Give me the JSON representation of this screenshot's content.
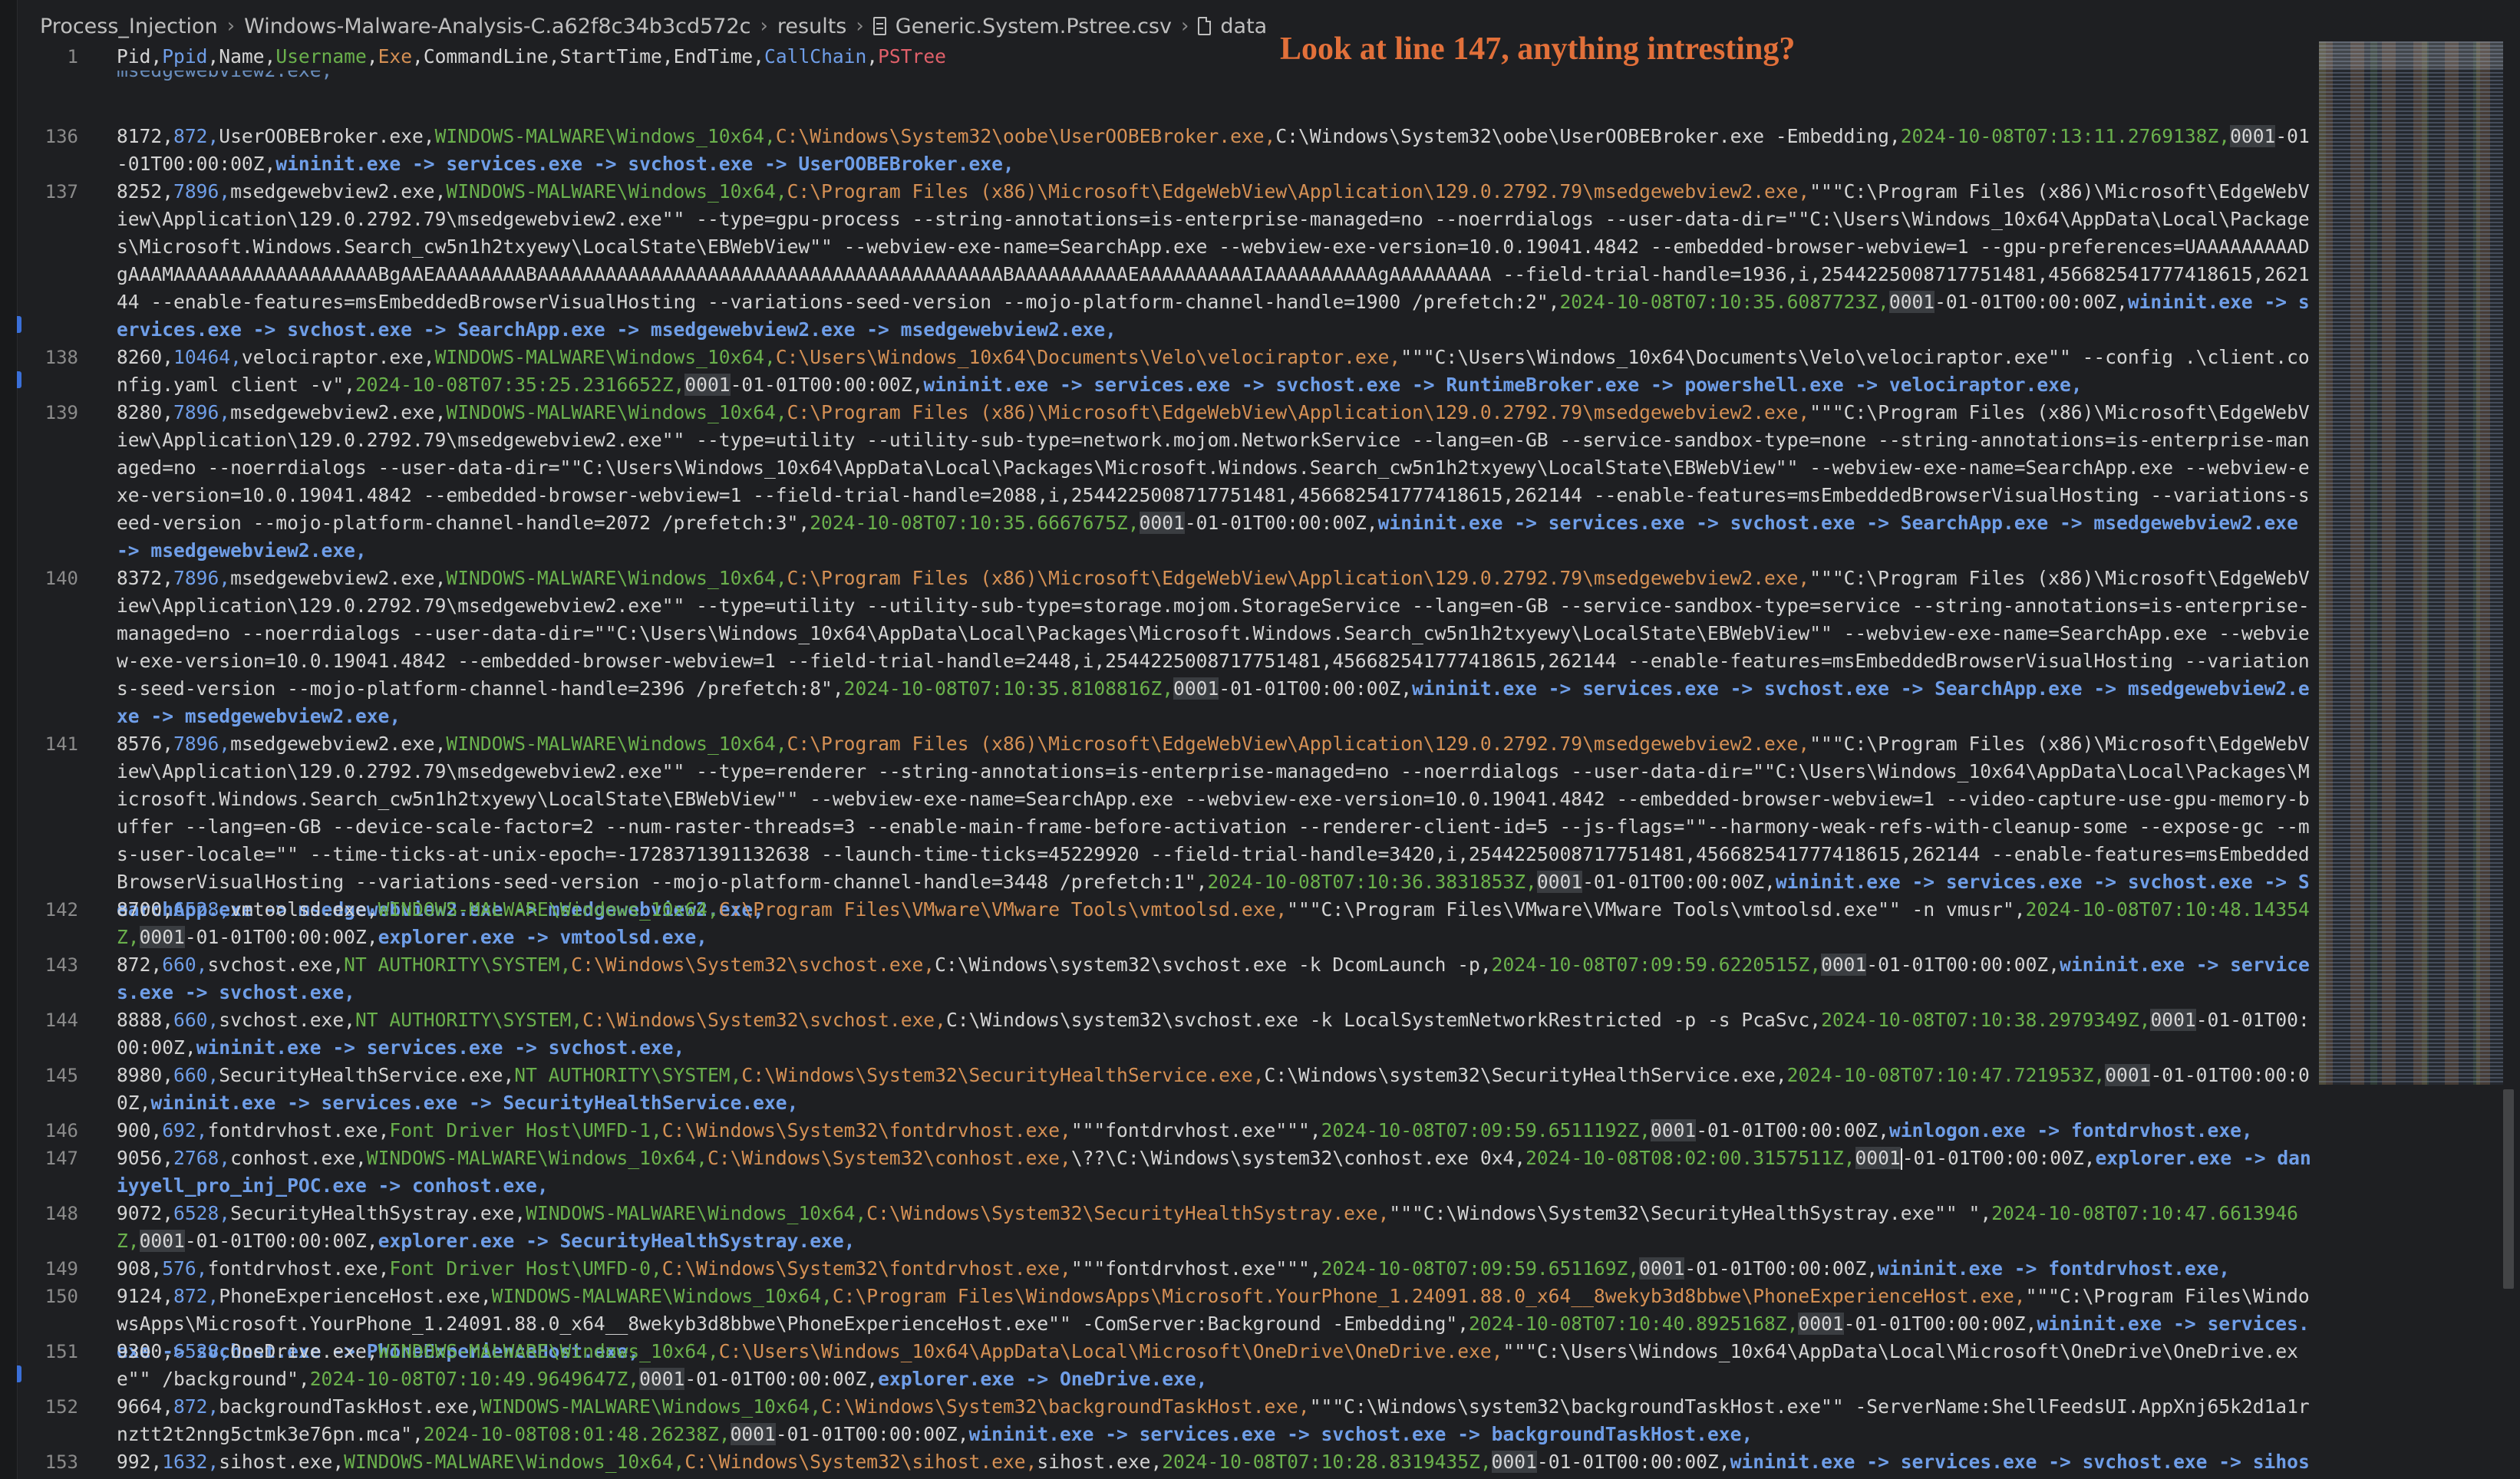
{
  "breadcrumb": {
    "items": [
      "Process_Injection",
      "Windows-Malware-Analysis-C.a62f8c34b3cd572c",
      "results",
      "Generic.System.Pstree.csv",
      "data"
    ]
  },
  "annotation": "Look at line 147, anything intresting?",
  "header": {
    "line_number": "1",
    "cols_plain1": "Pid,",
    "col_ppid": "Ppid",
    "cols_plain2": ",Name,",
    "col_username": "Username",
    "col_sep1": ",",
    "col_exe": "Exe",
    "cols_plain3": ",CommandLine,StartTime,EndTime,",
    "col_callchain": "CallChain",
    "col_sep2": ",",
    "col_pstree": "PSTree"
  },
  "scrolled_fragment": "msedgewebview2.exe,",
  "lines": [
    {
      "n": "136",
      "pid": "8172,",
      "ppid": "872,",
      "name": "UserOOBEBroker.exe,",
      "user": "WINDOWS-MALWARE\\Windows_10x64,",
      "exe": "C:\\Windows\\System32\\oobe\\UserOOBEBroker.exe,",
      "cmd": "C:\\Windows\\System32\\oobe\\UserOOBEBroker.exe -Embedding,",
      "start": "2024-10-08T07:13:11.2769138Z,",
      "zero": "0001",
      "end": "-01-01T00:00:00Z,",
      "chain": "wininit.exe -> services.exe -> svchost.exe -> UserOOBEBroker.exe,"
    },
    {
      "n": "137",
      "pid": "8252,",
      "ppid": "7896,",
      "name": "msedgewebview2.exe,",
      "user": "WINDOWS-MALWARE\\Windows_10x64,",
      "exe": "C:\\Program Files (x86)\\Microsoft\\EdgeWebView\\Application\\129.0.2792.79\\msedgewebview2.exe,",
      "cmd": "\"\"\"C:\\Program Files (x86)\\Microsoft\\EdgeWebView\\Application\\129.0.2792.79\\msedgewebview2.exe\"\" --type=gpu-process --string-annotations=is-enterprise-managed=no --noerrdialogs --user-data-dir=\"\"C:\\Users\\Windows_10x64\\AppData\\Local\\Packages\\Microsoft.Windows.Search_cw5n1h2txyewy\\LocalState\\EBWebView\"\" --webview-exe-name=SearchApp.exe --webview-exe-version=10.0.19041.4842 --embedded-browser-webview=1 --gpu-preferences=UAAAAAAAAADgAAAMAAAAAAAAAAAAAAAAAABgAAEAAAAAAAABAAAAAAAAAAAAAAAAAAAAAAAAAAAAAAAAAAAAAAAAABAAAAAAAAAAEAAAAAAAAAAIAAAAAAAAAAgAAAAAAAAA --field-trial-handle=1936,i,2544225008717751481,456682541777418615,262144 --enable-features=msEmbeddedBrowserVisualHosting --variations-seed-version --mojo-platform-channel-handle=1900 /prefetch:2\",",
      "start": "2024-10-08T07:10:35.6087723Z,",
      "zero": "0001",
      "end": "-01-01T00:00:00Z,",
      "chain": "wininit.exe -> services.exe -> svchost.exe -> SearchApp.exe -> msedgewebview2.exe -> msedgewebview2.exe,"
    },
    {
      "n": "138",
      "pid": "8260,",
      "ppid": "10464,",
      "name": "velociraptor.exe,",
      "user": "WINDOWS-MALWARE\\Windows_10x64,",
      "exe": "C:\\Users\\Windows_10x64\\Documents\\Velo\\velociraptor.exe,",
      "cmd": "\"\"\"C:\\Users\\Windows_10x64\\Documents\\Velo\\velociraptor.exe\"\" --config .\\client.config.yaml client -v\",",
      "start": "2024-10-08T07:35:25.2316652Z,",
      "zero": "0001",
      "end": "-01-01T00:00:00Z,",
      "chain": "wininit.exe -> services.exe -> svchost.exe -> RuntimeBroker.exe -> powershell.exe -> velociraptor.exe,"
    },
    {
      "n": "139",
      "pid": "8280,",
      "ppid": "7896,",
      "name": "msedgewebview2.exe,",
      "user": "WINDOWS-MALWARE\\Windows_10x64,",
      "exe": "C:\\Program Files (x86)\\Microsoft\\EdgeWebView\\Application\\129.0.2792.79\\msedgewebview2.exe,",
      "cmd": "\"\"\"C:\\Program Files (x86)\\Microsoft\\EdgeWebView\\Application\\129.0.2792.79\\msedgewebview2.exe\"\" --type=utility --utility-sub-type=network.mojom.NetworkService --lang=en-GB --service-sandbox-type=none --string-annotations=is-enterprise-managed=no --noerrdialogs --user-data-dir=\"\"C:\\Users\\Windows_10x64\\AppData\\Local\\Packages\\Microsoft.Windows.Search_cw5n1h2txyewy\\LocalState\\EBWebView\"\" --webview-exe-name=SearchApp.exe --webview-exe-version=10.0.19041.4842 --embedded-browser-webview=1 --field-trial-handle=2088,i,2544225008717751481,456682541777418615,262144 --enable-features=msEmbeddedBrowserVisualHosting --variations-seed-version --mojo-platform-channel-handle=2072 /prefetch:3\",",
      "start": "2024-10-08T07:10:35.6667675Z,",
      "zero": "0001",
      "end": "-01-01T00:00:00Z,",
      "chain": "wininit.exe -> services.exe -> svchost.exe -> SearchApp.exe -> msedgewebview2.exe -> msedgewebview2.exe,"
    },
    {
      "n": "140",
      "pid": "8372,",
      "ppid": "7896,",
      "name": "msedgewebview2.exe,",
      "user": "WINDOWS-MALWARE\\Windows_10x64,",
      "exe": "C:\\Program Files (x86)\\Microsoft\\EdgeWebView\\Application\\129.0.2792.79\\msedgewebview2.exe,",
      "cmd": "\"\"\"C:\\Program Files (x86)\\Microsoft\\EdgeWebView\\Application\\129.0.2792.79\\msedgewebview2.exe\"\" --type=utility --utility-sub-type=storage.mojom.StorageService --lang=en-GB --service-sandbox-type=service --string-annotations=is-enterprise-managed=no --noerrdialogs --user-data-dir=\"\"C:\\Users\\Windows_10x64\\AppData\\Local\\Packages\\Microsoft.Windows.Search_cw5n1h2txyewy\\LocalState\\EBWebView\"\" --webview-exe-name=SearchApp.exe --webview-exe-version=10.0.19041.4842 --embedded-browser-webview=1 --field-trial-handle=2448,i,2544225008717751481,456682541777418615,262144 --enable-features=msEmbeddedBrowserVisualHosting --variations-seed-version --mojo-platform-channel-handle=2396 /prefetch:8\",",
      "start": "2024-10-08T07:10:35.8108816Z,",
      "zero": "0001",
      "end": "-01-01T00:00:00Z,",
      "chain": "wininit.exe -> services.exe -> svchost.exe -> SearchApp.exe -> msedgewebview2.exe -> msedgewebview2.exe,"
    },
    {
      "n": "141",
      "pid": "8576,",
      "ppid": "7896,",
      "name": "msedgewebview2.exe,",
      "user": "WINDOWS-MALWARE\\Windows_10x64,",
      "exe": "C:\\Program Files (x86)\\Microsoft\\EdgeWebView\\Application\\129.0.2792.79\\msedgewebview2.exe,",
      "cmd": "\"\"\"C:\\Program Files (x86)\\Microsoft\\EdgeWebView\\Application\\129.0.2792.79\\msedgewebview2.exe\"\" --type=renderer --string-annotations=is-enterprise-managed=no --noerrdialogs --user-data-dir=\"\"C:\\Users\\Windows_10x64\\AppData\\Local\\Packages\\Microsoft.Windows.Search_cw5n1h2txyewy\\LocalState\\EBWebView\"\" --webview-exe-name=SearchApp.exe --webview-exe-version=10.0.19041.4842 --embedded-browser-webview=1 --video-capture-use-gpu-memory-buffer --lang=en-GB --device-scale-factor=2 --num-raster-threads=3 --enable-main-frame-before-activation --renderer-client-id=5 --js-flags=\"\"--harmony-weak-refs-with-cleanup-some --expose-gc --ms-user-locale=\"\" --time-ticks-at-unix-epoch=-1728371391132638 --launch-time-ticks=45229920 --field-trial-handle=3420,i,2544225008717751481,456682541777418615,262144 --enable-features=msEmbeddedBrowserVisualHosting --variations-seed-version --mojo-platform-channel-handle=3448 /prefetch:1\",",
      "start": "2024-10-08T07:10:36.3831853Z,",
      "zero": "0001",
      "end": "-01-01T00:00:00Z,",
      "chain": "wininit.exe -> services.exe -> svchost.exe -> SearchApp.exe -> msedgewebview2.exe -> msedgewebview2.exe,"
    },
    {
      "n": "142",
      "pid": "8700,",
      "ppid": "6528,",
      "name": "vmtoolsd.exe,",
      "user": "WINDOWS-MALWARE\\Windows_10x64,",
      "exe": "C:\\Program Files\\VMware\\VMware Tools\\vmtoolsd.exe,",
      "cmd": "\"\"\"C:\\Program Files\\VMware\\VMware Tools\\vmtoolsd.exe\"\" -n vmusr\",",
      "start": "2024-10-08T07:10:48.14354Z,",
      "zero": "0001",
      "end": "-01-01T00:00:00Z,",
      "chain": "explorer.exe -> vmtoolsd.exe,"
    },
    {
      "n": "143",
      "pid": "872,",
      "ppid": "660,",
      "name": "svchost.exe,",
      "user": "NT AUTHORITY\\SYSTEM,",
      "exe": "C:\\Windows\\System32\\svchost.exe,",
      "cmd": "C:\\Windows\\system32\\svchost.exe -k DcomLaunch -p,",
      "start": "2024-10-08T07:09:59.6220515Z,",
      "zero": "0001",
      "end": "-01-01T00:00:00Z,",
      "chain": "wininit.exe -> services.exe -> svchost.exe,"
    },
    {
      "n": "144",
      "pid": "8888,",
      "ppid": "660,",
      "name": "svchost.exe,",
      "user": "NT AUTHORITY\\SYSTEM,",
      "exe": "C:\\Windows\\System32\\svchost.exe,",
      "cmd": "C:\\Windows\\system32\\svchost.exe -k LocalSystemNetworkRestricted -p -s PcaSvc,",
      "start": "2024-10-08T07:10:38.2979349Z,",
      "zero": "0001",
      "end": "-01-01T00:00:00Z,",
      "chain": "wininit.exe -> services.exe -> svchost.exe,"
    },
    {
      "n": "145",
      "pid": "8980,",
      "ppid": "660,",
      "name": "SecurityHealthService.exe,",
      "user": "NT AUTHORITY\\SYSTEM,",
      "exe": "C:\\Windows\\System32\\SecurityHealthService.exe,",
      "cmd": "C:\\Windows\\system32\\SecurityHealthService.exe,",
      "start": "2024-10-08T07:10:47.721953Z,",
      "zero": "0001",
      "end": "-01-01T00:00:00Z,",
      "chain": "wininit.exe -> services.exe -> SecurityHealthService.exe,"
    },
    {
      "n": "146",
      "pid": "900,",
      "ppid": "692,",
      "name": "fontdrvhost.exe,",
      "user": "Font Driver Host\\UMFD-1,",
      "exe": "C:\\Windows\\System32\\fontdrvhost.exe,",
      "cmd": "\"\"\"fontdrvhost.exe\"\"\",",
      "start": "2024-10-08T07:09:59.6511192Z,",
      "zero": "0001",
      "end": "-01-01T00:00:00Z,",
      "chain": "winlogon.exe -> fontdrvhost.exe,"
    },
    {
      "n": "147",
      "pid": "9056,",
      "ppid": "2768,",
      "name": "conhost.exe,",
      "user": "WINDOWS-MALWARE\\Windows_10x64,",
      "exe": "C:\\Windows\\System32\\conhost.exe,",
      "cmd": "\\??\\C:\\Windows\\system32\\conhost.exe 0x4,",
      "start": "2024-10-08T08:02:00.3157511Z,",
      "zero": "0001",
      "end": "-01-01T00:00:00Z,",
      "chain": "explorer.exe -> daniyyell_pro_inj_POC.exe -> conhost.exe,",
      "cursor": true
    },
    {
      "n": "148",
      "pid": "9072,",
      "ppid": "6528,",
      "name": "SecurityHealthSystray.exe,",
      "user": "WINDOWS-MALWARE\\Windows_10x64,",
      "exe": "C:\\Windows\\System32\\SecurityHealthSystray.exe,",
      "cmd": "\"\"\"C:\\Windows\\System32\\SecurityHealthSystray.exe\"\" \",",
      "start": "2024-10-08T07:10:47.6613946Z,",
      "zero": "0001",
      "end": "-01-01T00:00:00Z,",
      "chain": "explorer.exe -> SecurityHealthSystray.exe,"
    },
    {
      "n": "149",
      "pid": "908,",
      "ppid": "576,",
      "name": "fontdrvhost.exe,",
      "user": "Font Driver Host\\UMFD-0,",
      "exe": "C:\\Windows\\System32\\fontdrvhost.exe,",
      "cmd": "\"\"\"fontdrvhost.exe\"\"\",",
      "start": "2024-10-08T07:09:59.651169Z,",
      "zero": "0001",
      "end": "-01-01T00:00:00Z,",
      "chain": "wininit.exe -> fontdrvhost.exe,"
    },
    {
      "n": "150",
      "pid": "9124,",
      "ppid": "872,",
      "name": "PhoneExperienceHost.exe,",
      "user": "WINDOWS-MALWARE\\Windows_10x64,",
      "exe": "C:\\Program Files\\WindowsApps\\Microsoft.YourPhone_1.24091.88.0_x64__8wekyb3d8bbwe\\PhoneExperienceHost.exe,",
      "cmd": "\"\"\"C:\\Program Files\\WindowsApps\\Microsoft.YourPhone_1.24091.88.0_x64__8wekyb3d8bbwe\\PhoneExperienceHost.exe\"\" -ComServer:Background -Embedding\",",
      "start": "2024-10-08T07:10:40.8925168Z,",
      "zero": "0001",
      "end": "-01-01T00:00:00Z,",
      "chain": "wininit.exe -> services.exe -> svchost.exe -> PhoneExperienceHost.exe,"
    },
    {
      "n": "151",
      "pid": "9300,",
      "ppid": "6528,",
      "name": "OneDrive.exe,",
      "user": "WINDOWS-MALWARE\\Windows_10x64,",
      "exe": "C:\\Users\\Windows_10x64\\AppData\\Local\\Microsoft\\OneDrive\\OneDrive.exe,",
      "cmd": "\"\"\"C:\\Users\\Windows_10x64\\AppData\\Local\\Microsoft\\OneDrive\\OneDrive.exe\"\" /background\",",
      "start": "2024-10-08T07:10:49.9649647Z,",
      "zero": "0001",
      "end": "-01-01T00:00:00Z,",
      "chain": "explorer.exe -> OneDrive.exe,"
    },
    {
      "n": "152",
      "pid": "9664,",
      "ppid": "872,",
      "name": "backgroundTaskHost.exe,",
      "user": "WINDOWS-MALWARE\\Windows_10x64,",
      "exe": "C:\\Windows\\System32\\backgroundTaskHost.exe,",
      "cmd": "\"\"\"C:\\Windows\\system32\\backgroundTaskHost.exe\"\" -ServerName:ShellFeedsUI.AppXnj65k2d1a1rnztt2t2nng5ctmk3e76pn.mca\",",
      "start": "2024-10-08T08:01:48.26238Z,",
      "zero": "0001",
      "end": "-01-01T00:00:00Z,",
      "chain": "wininit.exe -> services.exe -> svchost.exe -> backgroundTaskHost.exe,"
    },
    {
      "n": "153",
      "pid": "992,",
      "ppid": "1632,",
      "name": "sihost.exe,",
      "user": "WINDOWS-MALWARE\\Windows_10x64,",
      "exe": "C:\\Windows\\System32\\sihost.exe,",
      "cmd": "sihost.exe,",
      "start": "2024-10-08T07:10:28.8319435Z,",
      "zero": "0001",
      "end": "-01-01T00:00:00Z,",
      "chain": "wininit.exe -> services.exe -> svchost.exe -> sihost.exe,"
    }
  ],
  "colors": {
    "background": "#1e1f22",
    "line_number": "#8b8b8b",
    "ppid": "#6f9ee8",
    "username": "#6ab04c",
    "exe": "#d59054",
    "callchain": "#6f9ee8",
    "pstree": "#e0606a",
    "annotation": "#e2703a"
  },
  "icons": {
    "breadcrumb_separator": "chevron-right-icon",
    "csv_file": "table-file-icon",
    "data_symbol": "file-icon"
  }
}
